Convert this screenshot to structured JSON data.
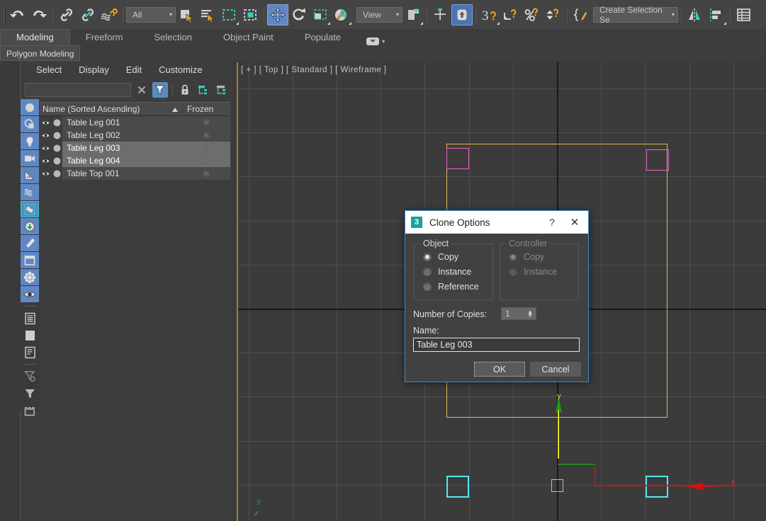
{
  "app": {
    "title": "3ds Max"
  },
  "toolbar": {
    "items": [
      {
        "name": "undo-icon",
        "label": "Undo"
      },
      {
        "name": "redo-icon",
        "label": "Redo"
      },
      {
        "name": "select-and-link-icon",
        "label": "Select and Link"
      },
      {
        "name": "unlink-selection-icon",
        "label": "Unlink Selection"
      },
      {
        "name": "bind-to-space-warp-icon",
        "label": "Bind to Space Warp"
      },
      {
        "name": "selection-filter-dropdown",
        "label": "All"
      },
      {
        "name": "select-object-icon",
        "label": "Select Object"
      },
      {
        "name": "select-by-name-icon",
        "label": "Select by Name"
      },
      {
        "name": "rectangular-selection-region-icon",
        "label": "Rectangular Selection Region"
      },
      {
        "name": "window-crossing-icon",
        "label": "Window / Crossing"
      },
      {
        "name": "select-and-move-icon",
        "label": "Select and Move"
      },
      {
        "name": "select-and-rotate-icon",
        "label": "Select and Rotate"
      },
      {
        "name": "select-and-scale-icon",
        "label": "Select and Uniform Scale"
      },
      {
        "name": "select-and-place-icon",
        "label": "Select and Place"
      },
      {
        "name": "reference-coordinate-system-dropdown",
        "label": "View"
      },
      {
        "name": "use-pivot-point-center-icon",
        "label": "Use Pivot Point Center"
      },
      {
        "name": "select-and-manipulate-icon",
        "label": "Select and Manipulate"
      },
      {
        "name": "snaps-toggle-icon",
        "label": "Snaps Toggle (3)"
      },
      {
        "name": "angle-snap-toggle-icon",
        "label": "Angle Snap Toggle"
      },
      {
        "name": "percent-snap-toggle-icon",
        "label": "Percent Snap Toggle"
      },
      {
        "name": "spinner-snap-toggle-icon",
        "label": "Spinner Snap Toggle"
      },
      {
        "name": "edit-named-selection-sets-icon",
        "label": "Edit Named Selection Sets"
      },
      {
        "name": "named-selection-set-dropdown",
        "label": "Create Selection Se"
      },
      {
        "name": "mirror-icon",
        "label": "Mirror"
      },
      {
        "name": "align-icon",
        "label": "Align"
      },
      {
        "name": "scene-explorer-icon",
        "label": "Toggle Scene Explorer"
      }
    ],
    "selection_filter": "All",
    "coordinate_system": "View",
    "named_selection_set": "Create Selection Se",
    "caret": "▾"
  },
  "ribbon": {
    "tabs": [
      {
        "label": "Modeling",
        "active": true
      },
      {
        "label": "Freeform",
        "active": false
      },
      {
        "label": "Selection",
        "active": false
      },
      {
        "label": "Object Paint",
        "active": false
      },
      {
        "label": "Populate",
        "active": false
      }
    ],
    "sub_tab": "Polygon Modeling"
  },
  "explorer": {
    "menu": [
      "Select",
      "Display",
      "Edit",
      "Customize"
    ],
    "search_value": "",
    "buttons": [
      {
        "name": "clear-search-icon",
        "label": "×"
      },
      {
        "name": "filter-icon",
        "label": "Filter"
      },
      {
        "name": "lock-icon",
        "label": "Lock"
      },
      {
        "name": "expand-all-icon",
        "label": "Expand All"
      },
      {
        "name": "collapse-all-icon",
        "label": "Collapse All"
      }
    ],
    "columns": [
      "Name (Sorted Ascending)",
      "Frozen"
    ],
    "rows": [
      {
        "name": "Table Leg 001",
        "selected": false,
        "frozen": false
      },
      {
        "name": "Table Leg 002",
        "selected": false,
        "frozen": false
      },
      {
        "name": "Table Leg 003",
        "selected": true,
        "frozen": false
      },
      {
        "name": "Table Leg 004",
        "selected": true,
        "frozen": false
      },
      {
        "name": "Table Top 001",
        "selected": false,
        "frozen": false
      }
    ]
  },
  "left_toolbar": {
    "items": [
      {
        "name": "display-geometry-icon",
        "active": true
      },
      {
        "name": "display-shapes-icon",
        "active": true
      },
      {
        "name": "display-lights-icon",
        "active": true
      },
      {
        "name": "display-cameras-icon",
        "active": true
      },
      {
        "name": "display-helpers-icon",
        "active": true
      },
      {
        "name": "display-space-warps-icon",
        "active": true
      },
      {
        "name": "display-groups-icon",
        "active": true
      },
      {
        "name": "display-xrefs-icon",
        "active": true
      },
      {
        "name": "display-bones-icon",
        "active": true
      },
      {
        "name": "display-containers-icon",
        "active": true
      },
      {
        "name": "display-particles-icon",
        "active": true
      },
      {
        "name": "display-visibility-icon",
        "active": true
      },
      {
        "name": "list-view-icon",
        "active": false
      },
      {
        "name": "panel-view-icon",
        "active": false
      },
      {
        "name": "detail-view-icon",
        "active": false
      },
      {
        "name": "configure-filter-icon",
        "active": false
      },
      {
        "name": "apply-filter-icon",
        "active": false
      },
      {
        "name": "container-icon",
        "active": false
      }
    ]
  },
  "viewport": {
    "label": "[ + ] [ Top ] [ Standard ] [ Wireframe ]",
    "axis_labels": {
      "x": "x",
      "y": "y",
      "corner_y": "y"
    },
    "objects": [
      {
        "name": "table-top",
        "color": "#e0bb52"
      },
      {
        "name": "table-leg-001",
        "color": "#e862c8"
      },
      {
        "name": "table-leg-002",
        "color": "#e862c8"
      },
      {
        "name": "table-leg-003",
        "color": "#52e8ef"
      },
      {
        "name": "table-leg-004",
        "color": "#52e8ef"
      },
      {
        "name": "pivot-box",
        "color": "#bdbdbd"
      }
    ],
    "colors": {
      "background": "#3b3b3b",
      "grid": "#4f4f4f",
      "axis": "#181818",
      "selected": "#52e8ef",
      "unselected": "#e862c8",
      "gizmo_x": "#cc1414",
      "gizmo_y": "#e4e41c",
      "gizmo_green": "#17a017"
    }
  },
  "dialog": {
    "title": "Clone Options",
    "icon_label": "3",
    "help_label": "?",
    "close_label": "✕",
    "object_group": {
      "label": "Object",
      "options": [
        {
          "label": "Copy",
          "checked": true
        },
        {
          "label": "Instance",
          "checked": false
        },
        {
          "label": "Reference",
          "checked": false
        }
      ]
    },
    "controller_group": {
      "label": "Controller",
      "disabled": true,
      "options": [
        {
          "label": "Copy",
          "checked": true
        },
        {
          "label": "Instance",
          "checked": false
        }
      ]
    },
    "copies_label": "Number of Copies:",
    "copies_value": "1",
    "name_label": "Name:",
    "name_value": "Table Leg 003",
    "ok_label": "OK",
    "cancel_label": "Cancel"
  }
}
